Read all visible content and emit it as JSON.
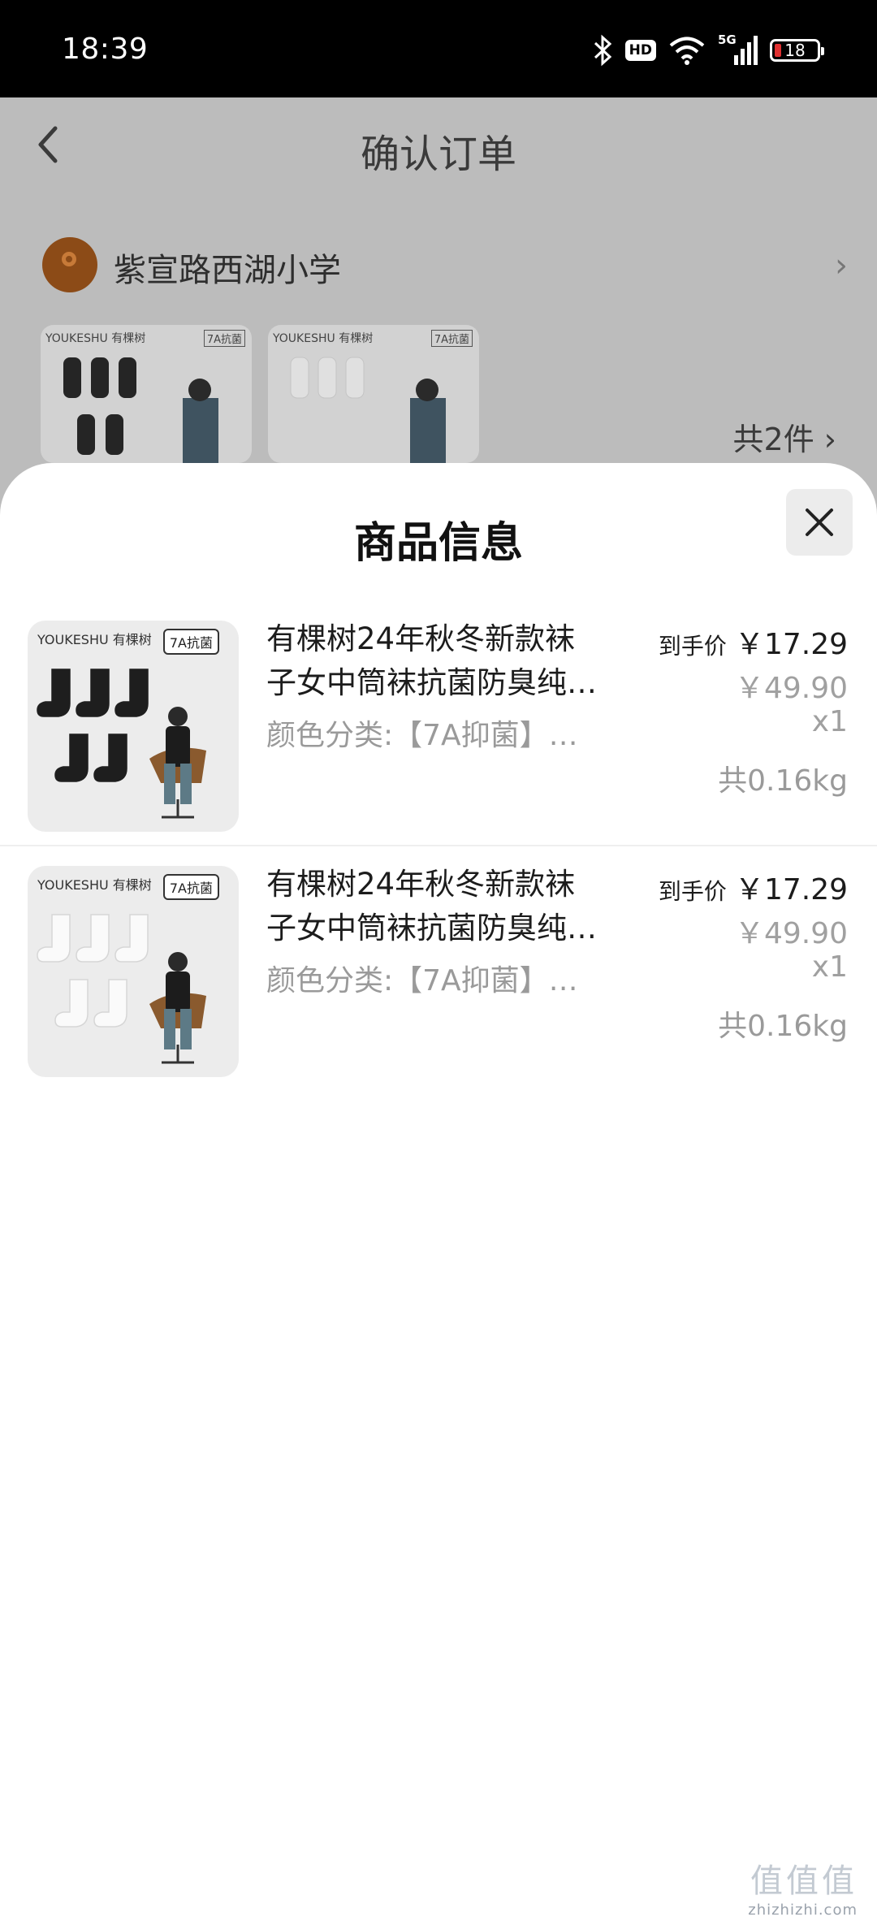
{
  "status_bar": {
    "time": "18:39",
    "hd": "HD",
    "net": "5G",
    "battery": "18"
  },
  "background_page": {
    "title": "确认订单",
    "address": "紫宣路西湖小学",
    "product_brand": "YOUKESHU 有棵树",
    "product_tag": "7A抗菌",
    "item_count": "共2件"
  },
  "sheet": {
    "title": "商品信息",
    "items": [
      {
        "brand": "YOUKESHU 有棵树",
        "tag": "7A抗菌",
        "sock_color": "#1e1e1e",
        "title_line1": "有棵树24年秋冬新款袜",
        "title_line2": "子女中筒袜抗菌防臭纯…",
        "spec": "颜色分类:【7A抑菌】…",
        "price_label": "到手价",
        "price": "￥17.29",
        "original_price": "￥49.90",
        "quantity": "x1",
        "weight": "共0.16kg"
      },
      {
        "brand": "YOUKESHU 有棵树",
        "tag": "7A抗菌",
        "sock_color": "#fafafa",
        "title_line1": "有棵树24年秋冬新款袜",
        "title_line2": "子女中筒袜抗菌防臭纯…",
        "spec": "颜色分类:【7A抑菌】…",
        "price_label": "到手价",
        "price": "￥17.29",
        "original_price": "￥49.90",
        "quantity": "x1",
        "weight": "共0.16kg"
      }
    ]
  },
  "watermark": {
    "text": "zhizhizhi.com",
    "glyphs": "值值值"
  }
}
